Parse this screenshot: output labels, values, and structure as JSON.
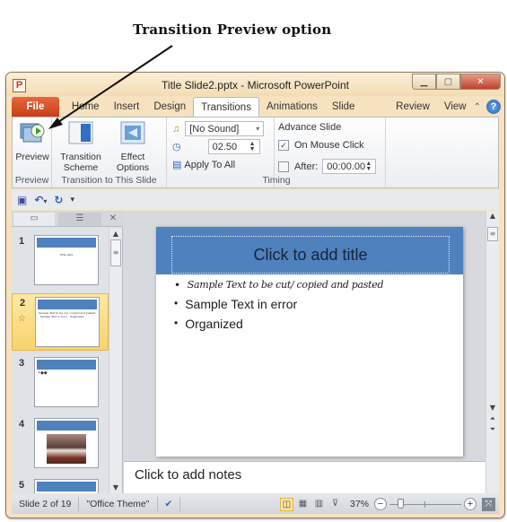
{
  "annotation": {
    "caption": "Transition Preview option"
  },
  "window": {
    "app_icon": "P",
    "title": "Title Slide2.pptx - Microsoft PowerPoint",
    "controls": {
      "minimize": "minimize-icon",
      "restore": "restore-icon",
      "close": "close-icon"
    }
  },
  "tabs": {
    "file": "File",
    "items": [
      "Home",
      "Insert",
      "Design",
      "Transitions",
      "Animations",
      "Slide Show",
      "Review",
      "View"
    ],
    "active": "Transitions",
    "help": "?"
  },
  "ribbon": {
    "preview": {
      "button": "Preview",
      "group": "Preview"
    },
    "transition": {
      "scheme": "Transition Scheme",
      "scheme_arrow": "▾",
      "effect": "Effect Options",
      "effect_arrow": "▾",
      "group": "Transition to This Slide"
    },
    "timing": {
      "sound": "[No Sound]",
      "duration": "02.50",
      "apply_all": "Apply To All",
      "advance_label": "Advance Slide",
      "on_mouse_click": "On Mouse Click",
      "on_mouse_click_checked": true,
      "after_label": "After:",
      "after_checked": false,
      "after_value": "00:00.00",
      "group": "Timing"
    }
  },
  "qat": {
    "save": "save-icon",
    "undo": "undo-icon",
    "redo": "redo-icon",
    "customize": "customize-icon"
  },
  "slides_pane": {
    "thumbnails": [
      {
        "number": "1",
        "text": "Title slide",
        "selected": false
      },
      {
        "number": "2",
        "text": "Sample Text to be cut / copied and pasted · Sample Text in error · Organized",
        "selected": true
      },
      {
        "number": "3",
        "text": "•◆◆",
        "selected": false
      },
      {
        "number": "4",
        "text": "",
        "selected": false
      },
      {
        "number": "5",
        "text": "",
        "selected": false
      }
    ]
  },
  "slide": {
    "title_placeholder": "Click to add title",
    "bullets": [
      "Sample Text to be cut/ copied and pasted",
      "Sample Text in error",
      "Organized"
    ]
  },
  "notes": {
    "placeholder": "Click to add notes"
  },
  "status": {
    "slide_info": "Slide 2 of 19",
    "theme": "\"Office Theme\"",
    "zoom": "37%",
    "zoom_percent": 37,
    "minus": "−",
    "plus": "+"
  }
}
